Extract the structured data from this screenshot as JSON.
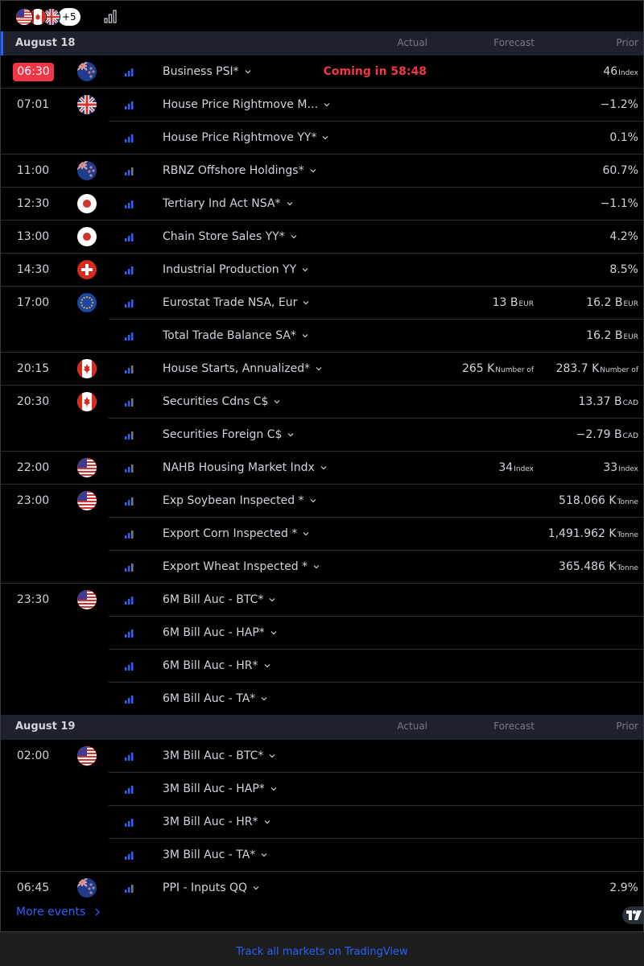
{
  "toolbar": {
    "more_countries": "+5"
  },
  "columns": {
    "actual": "Actual",
    "forecast": "Forecast",
    "prior": "Prior"
  },
  "dates": [
    {
      "date": "August 18"
    },
    {
      "date": "August 19"
    }
  ],
  "events": [
    {
      "time": "06:30",
      "flag": "nz",
      "title": "Business PSI*",
      "coming": "Coming in 58:48",
      "prior": "46",
      "prior_unit": "Index",
      "importance": 1
    },
    {
      "time": "07:01",
      "flag": "gb",
      "title": "House Price Rightmove M…",
      "prior": "−1.2%",
      "importance": 1
    },
    {
      "title": "House Price Rightmove YY*",
      "prior": "0.1%",
      "importance": 1
    },
    {
      "time": "11:00",
      "flag": "nz",
      "title": "RBNZ Offshore Holdings*",
      "prior": "60.7%",
      "importance": 0
    },
    {
      "time": "12:30",
      "flag": "jp",
      "title": "Tertiary Ind Act NSA*",
      "prior": "−1.1%",
      "importance": 1
    },
    {
      "time": "13:00",
      "flag": "jp",
      "title": "Chain Store Sales YY*",
      "prior": "4.2%",
      "importance": 1
    },
    {
      "time": "14:30",
      "flag": "ch",
      "title": "Industrial Production YY",
      "prior": "8.5%",
      "importance": 1
    },
    {
      "time": "17:00",
      "flag": "eu",
      "title": "Eurostat Trade NSA, Eur",
      "forecast": "13 B",
      "forecast_unit": "EUR",
      "prior": "16.2 B",
      "prior_unit": "EUR",
      "importance": 1
    },
    {
      "title": "Total Trade Balance SA*",
      "prior": "16.2 B",
      "prior_unit": "EUR",
      "importance": 1
    },
    {
      "time": "20:15",
      "flag": "ca",
      "title": "House Starts, Annualized*",
      "forecast": "265 K",
      "forecast_unit": "Number of",
      "prior": "283.7 K",
      "prior_unit": "Number of",
      "importance": 0
    },
    {
      "time": "20:30",
      "flag": "ca",
      "title": "Securities Cdns C$",
      "prior": "13.37 B",
      "prior_unit": "CAD",
      "importance": 0
    },
    {
      "title": "Securities Foreign C$",
      "prior": "−2.79 B",
      "prior_unit": "CAD",
      "importance": 0
    },
    {
      "time": "22:00",
      "flag": "us",
      "title": "NAHB Housing Market Indx",
      "forecast": "34",
      "forecast_unit": "Index",
      "prior": "33",
      "prior_unit": "Index",
      "importance": 0
    },
    {
      "time": "23:00",
      "flag": "us",
      "title": "Exp Soybean Inspected *",
      "prior": "518.066 K",
      "prior_unit": "Tonne",
      "importance": 0
    },
    {
      "title": "Export Corn Inspected *",
      "prior": "1,491.962 K",
      "prior_unit": "Tonne",
      "importance": 0
    },
    {
      "title": "Export Wheat Inspected *",
      "prior": "365.486 K",
      "prior_unit": "Tonne",
      "importance": 0
    },
    {
      "time": "23:30",
      "flag": "us",
      "title": "6M Bill Auc - BTC*",
      "importance": 1
    },
    {
      "title": "6M Bill Auc - HAP*",
      "importance": 1
    },
    {
      "title": "6M Bill Auc - HR*",
      "importance": 1
    },
    {
      "title": "6M Bill Auc - TA*",
      "importance": 1
    },
    {
      "time": "02:00",
      "flag": "us",
      "title": "3M Bill Auc - BTC*",
      "importance": 1
    },
    {
      "title": "3M Bill Auc - HAP*",
      "importance": 1
    },
    {
      "title": "3M Bill Auc - HR*",
      "importance": 1
    },
    {
      "title": "3M Bill Auc - TA*",
      "importance": 1
    },
    {
      "time": "06:45",
      "flag": "nz",
      "title": "PPI - Inputs QQ",
      "prior": "2.9%",
      "importance": 0
    }
  ],
  "more_events": "More events",
  "footer_link": "Track all markets on TradingView",
  "colors": {
    "accent": "#2962ff",
    "live": "#f23645",
    "importance_on": "#2962ff",
    "importance_off": "#787b86"
  }
}
